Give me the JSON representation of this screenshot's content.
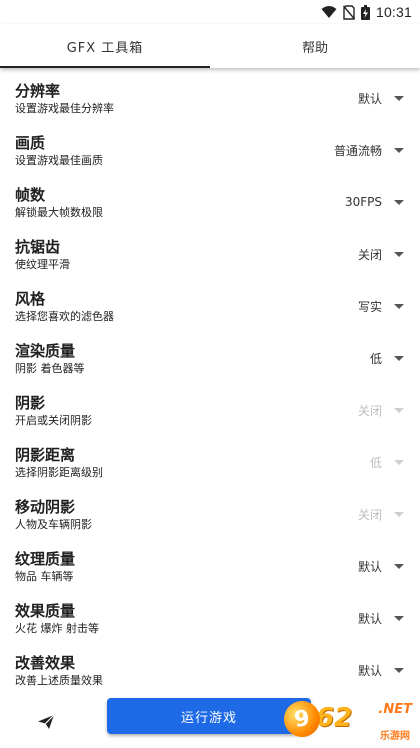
{
  "status_bar": {
    "time": "10:31",
    "icons": [
      "wifi-icon",
      "no-sim-icon",
      "battery-charging-icon"
    ]
  },
  "tabs": [
    {
      "label": "GFX 工具箱",
      "active": true
    },
    {
      "label": "帮助",
      "active": false
    }
  ],
  "settings": [
    {
      "title": "分辨率",
      "subtitle": "设置游戏最佳分辨率",
      "value": "默认",
      "disabled": false
    },
    {
      "title": "画质",
      "subtitle": "设置游戏最佳画质",
      "value": "普通流畅",
      "disabled": false
    },
    {
      "title": "帧数",
      "subtitle": "解锁最大帧数极限",
      "value": "30FPS",
      "disabled": false
    },
    {
      "title": "抗锯齿",
      "subtitle": "使纹理平滑",
      "value": "关闭",
      "disabled": false
    },
    {
      "title": "风格",
      "subtitle": "选择您喜欢的滤色器",
      "value": "写实",
      "disabled": false
    },
    {
      "title": "渲染质量",
      "subtitle": "阴影 着色器等",
      "value": "低",
      "disabled": false
    },
    {
      "title": "阴影",
      "subtitle": "开启或关闭阴影",
      "value": "关闭",
      "disabled": true
    },
    {
      "title": "阴影距离",
      "subtitle": "选择阴影距离级别",
      "value": "低",
      "disabled": true
    },
    {
      "title": "移动阴影",
      "subtitle": "人物及车辆阴影",
      "value": "关闭",
      "disabled": true
    },
    {
      "title": "纹理质量",
      "subtitle": "物品 车辆等",
      "value": "默认",
      "disabled": false
    },
    {
      "title": "效果质量",
      "subtitle": "火花 爆炸 射击等",
      "value": "默认",
      "disabled": false
    },
    {
      "title": "改善效果",
      "subtitle": "改善上述质量效果",
      "value": "默认",
      "disabled": false
    }
  ],
  "bottom_bar": {
    "send_icon": "send-icon",
    "run_label": "运行游戏"
  },
  "watermark": {
    "text": "962.NET",
    "sub": "乐游网"
  },
  "colors": {
    "accent": "#1e6ae6",
    "disabled": "#bdbdbd"
  }
}
